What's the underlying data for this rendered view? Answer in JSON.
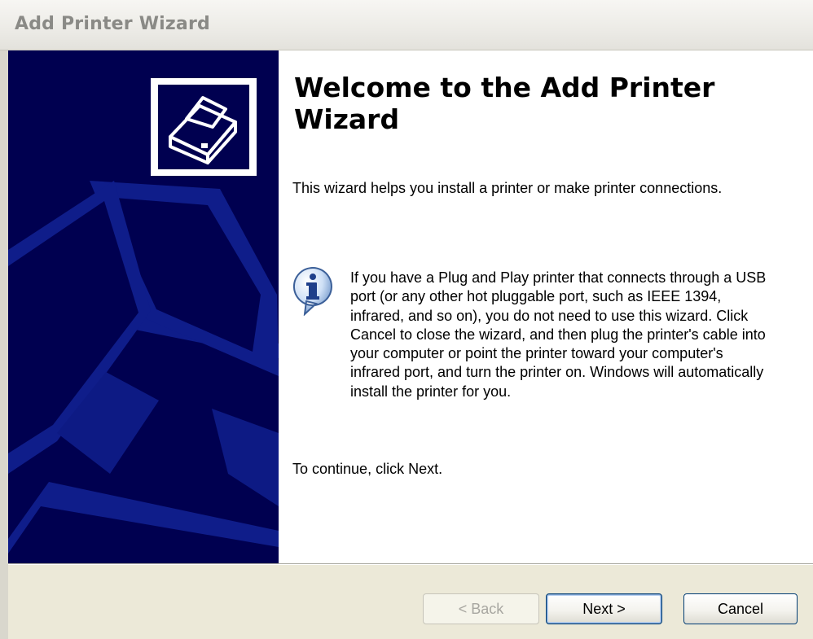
{
  "window": {
    "title": "Add Printer Wizard"
  },
  "sidebar": {
    "logo_icon": "printer-icon",
    "background_color": "#000050"
  },
  "content": {
    "heading": "Welcome to the Add Printer Wizard",
    "intro": "This wizard helps you install a printer or make printer connections.",
    "info_icon": "information-icon",
    "info_text": "If you have a Plug and Play printer that connects through a USB port (or any other hot pluggable port, such as IEEE 1394, infrared, and so on), you do not need to use this wizard. Click Cancel to close the wizard, and then plug the printer's cable into your computer or point the printer toward your computer's infrared port, and turn the printer on. Windows will automatically install the printer for you.",
    "continue_text": "To continue, click Next."
  },
  "buttons": {
    "back": "< Back",
    "next": "Next >",
    "cancel": "Cancel"
  }
}
